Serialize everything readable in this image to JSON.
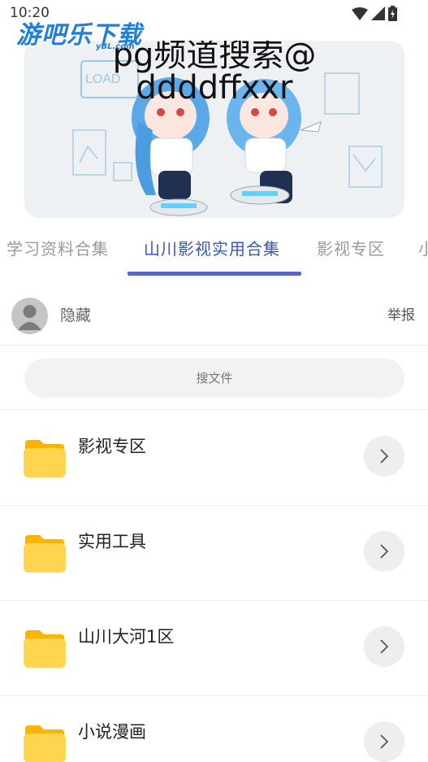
{
  "status_bar": {
    "time": "10:20"
  },
  "watermark": {
    "title": "游吧乐下载",
    "subtitle": "yBL.com"
  },
  "banner": {
    "caption_line1": "pg频道搜索@",
    "caption_line2": "ddddffxxr",
    "board_text": "LOAD"
  },
  "tabs": [
    {
      "label": "学习资料合集",
      "active": false
    },
    {
      "label": "山川影视实用合集",
      "active": true
    },
    {
      "label": "影视专区",
      "active": false
    },
    {
      "label": "小",
      "active": false
    }
  ],
  "user": {
    "name": "隐藏",
    "report_label": "举报"
  },
  "search": {
    "placeholder": "搜文件"
  },
  "folders": [
    {
      "name": "影视专区"
    },
    {
      "name": "实用工具"
    },
    {
      "name": "山川大河1区"
    },
    {
      "name": "小说漫画"
    }
  ],
  "colors": {
    "accent": "#5b67c6",
    "folder": "#ffd54f",
    "folder_tab": "#ffb300"
  }
}
